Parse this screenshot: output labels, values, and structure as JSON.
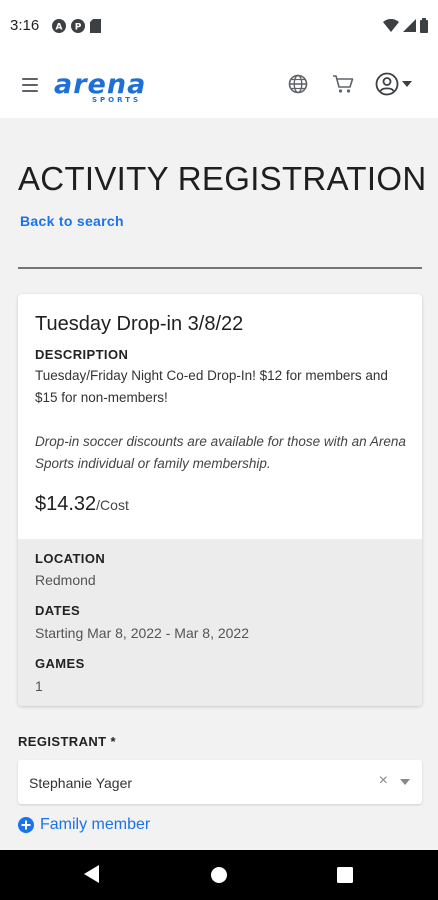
{
  "status_bar": {
    "time": "3:16",
    "left_icons": [
      "a-circle-icon",
      "p-circle-icon",
      "sd-card-icon"
    ],
    "right_icons": [
      "wifi-icon",
      "signal-icon",
      "battery-icon"
    ]
  },
  "header": {
    "logo_text": "arena",
    "logo_subtext": "SPORTS",
    "brand_color": "#1f6fd8",
    "icons": [
      "menu-icon",
      "globe-icon",
      "cart-icon",
      "account-icon",
      "caret-down-icon"
    ]
  },
  "page": {
    "title": "ACTIVITY REGISTRATION",
    "back_link": "Back to search"
  },
  "activity": {
    "title": "Tuesday Drop-in 3/8/22",
    "description_label": "DESCRIPTION",
    "description": "Tuesday/Friday Night Co-ed Drop-In! $12 for members and $15 for non-members!",
    "note": "Drop-in soccer discounts are available for those with an Arena Sports individual or family membership.",
    "price": "$14.32",
    "price_unit": "/Cost",
    "location_label": "LOCATION",
    "location": "Redmond",
    "dates_label": "DATES",
    "dates": "Starting Mar 8, 2022 - Mar 8, 2022",
    "games_label": "GAMES",
    "games": "1"
  },
  "registrant": {
    "label": "REGISTRANT *",
    "selected": "Stephanie Yager",
    "clear_symbol": "×",
    "add_family_label": "Family member"
  },
  "colors": {
    "accent": "#1a73e8",
    "background": "#f2f2f2",
    "card_details_bg": "#ececec"
  },
  "nav_bar": {
    "icons": [
      "back-icon",
      "home-icon",
      "recents-icon"
    ]
  }
}
